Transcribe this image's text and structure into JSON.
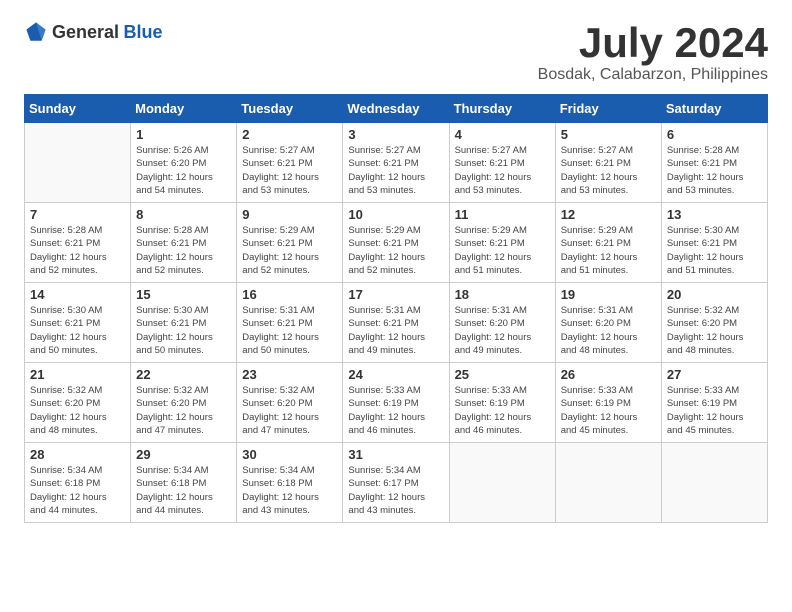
{
  "header": {
    "logo_general": "General",
    "logo_blue": "Blue",
    "month_year": "July 2024",
    "location": "Bosdak, Calabarzon, Philippines"
  },
  "weekdays": [
    "Sunday",
    "Monday",
    "Tuesday",
    "Wednesday",
    "Thursday",
    "Friday",
    "Saturday"
  ],
  "weeks": [
    [
      {
        "day": "",
        "info": ""
      },
      {
        "day": "1",
        "info": "Sunrise: 5:26 AM\nSunset: 6:20 PM\nDaylight: 12 hours\nand 54 minutes."
      },
      {
        "day": "2",
        "info": "Sunrise: 5:27 AM\nSunset: 6:21 PM\nDaylight: 12 hours\nand 53 minutes."
      },
      {
        "day": "3",
        "info": "Sunrise: 5:27 AM\nSunset: 6:21 PM\nDaylight: 12 hours\nand 53 minutes."
      },
      {
        "day": "4",
        "info": "Sunrise: 5:27 AM\nSunset: 6:21 PM\nDaylight: 12 hours\nand 53 minutes."
      },
      {
        "day": "5",
        "info": "Sunrise: 5:27 AM\nSunset: 6:21 PM\nDaylight: 12 hours\nand 53 minutes."
      },
      {
        "day": "6",
        "info": "Sunrise: 5:28 AM\nSunset: 6:21 PM\nDaylight: 12 hours\nand 53 minutes."
      }
    ],
    [
      {
        "day": "7",
        "info": "Sunrise: 5:28 AM\nSunset: 6:21 PM\nDaylight: 12 hours\nand 52 minutes."
      },
      {
        "day": "8",
        "info": "Sunrise: 5:28 AM\nSunset: 6:21 PM\nDaylight: 12 hours\nand 52 minutes."
      },
      {
        "day": "9",
        "info": "Sunrise: 5:29 AM\nSunset: 6:21 PM\nDaylight: 12 hours\nand 52 minutes."
      },
      {
        "day": "10",
        "info": "Sunrise: 5:29 AM\nSunset: 6:21 PM\nDaylight: 12 hours\nand 52 minutes."
      },
      {
        "day": "11",
        "info": "Sunrise: 5:29 AM\nSunset: 6:21 PM\nDaylight: 12 hours\nand 51 minutes."
      },
      {
        "day": "12",
        "info": "Sunrise: 5:29 AM\nSunset: 6:21 PM\nDaylight: 12 hours\nand 51 minutes."
      },
      {
        "day": "13",
        "info": "Sunrise: 5:30 AM\nSunset: 6:21 PM\nDaylight: 12 hours\nand 51 minutes."
      }
    ],
    [
      {
        "day": "14",
        "info": "Sunrise: 5:30 AM\nSunset: 6:21 PM\nDaylight: 12 hours\nand 50 minutes."
      },
      {
        "day": "15",
        "info": "Sunrise: 5:30 AM\nSunset: 6:21 PM\nDaylight: 12 hours\nand 50 minutes."
      },
      {
        "day": "16",
        "info": "Sunrise: 5:31 AM\nSunset: 6:21 PM\nDaylight: 12 hours\nand 50 minutes."
      },
      {
        "day": "17",
        "info": "Sunrise: 5:31 AM\nSunset: 6:21 PM\nDaylight: 12 hours\nand 49 minutes."
      },
      {
        "day": "18",
        "info": "Sunrise: 5:31 AM\nSunset: 6:20 PM\nDaylight: 12 hours\nand 49 minutes."
      },
      {
        "day": "19",
        "info": "Sunrise: 5:31 AM\nSunset: 6:20 PM\nDaylight: 12 hours\nand 48 minutes."
      },
      {
        "day": "20",
        "info": "Sunrise: 5:32 AM\nSunset: 6:20 PM\nDaylight: 12 hours\nand 48 minutes."
      }
    ],
    [
      {
        "day": "21",
        "info": "Sunrise: 5:32 AM\nSunset: 6:20 PM\nDaylight: 12 hours\nand 48 minutes."
      },
      {
        "day": "22",
        "info": "Sunrise: 5:32 AM\nSunset: 6:20 PM\nDaylight: 12 hours\nand 47 minutes."
      },
      {
        "day": "23",
        "info": "Sunrise: 5:32 AM\nSunset: 6:20 PM\nDaylight: 12 hours\nand 47 minutes."
      },
      {
        "day": "24",
        "info": "Sunrise: 5:33 AM\nSunset: 6:19 PM\nDaylight: 12 hours\nand 46 minutes."
      },
      {
        "day": "25",
        "info": "Sunrise: 5:33 AM\nSunset: 6:19 PM\nDaylight: 12 hours\nand 46 minutes."
      },
      {
        "day": "26",
        "info": "Sunrise: 5:33 AM\nSunset: 6:19 PM\nDaylight: 12 hours\nand 45 minutes."
      },
      {
        "day": "27",
        "info": "Sunrise: 5:33 AM\nSunset: 6:19 PM\nDaylight: 12 hours\nand 45 minutes."
      }
    ],
    [
      {
        "day": "28",
        "info": "Sunrise: 5:34 AM\nSunset: 6:18 PM\nDaylight: 12 hours\nand 44 minutes."
      },
      {
        "day": "29",
        "info": "Sunrise: 5:34 AM\nSunset: 6:18 PM\nDaylight: 12 hours\nand 44 minutes."
      },
      {
        "day": "30",
        "info": "Sunrise: 5:34 AM\nSunset: 6:18 PM\nDaylight: 12 hours\nand 43 minutes."
      },
      {
        "day": "31",
        "info": "Sunrise: 5:34 AM\nSunset: 6:17 PM\nDaylight: 12 hours\nand 43 minutes."
      },
      {
        "day": "",
        "info": ""
      },
      {
        "day": "",
        "info": ""
      },
      {
        "day": "",
        "info": ""
      }
    ]
  ]
}
